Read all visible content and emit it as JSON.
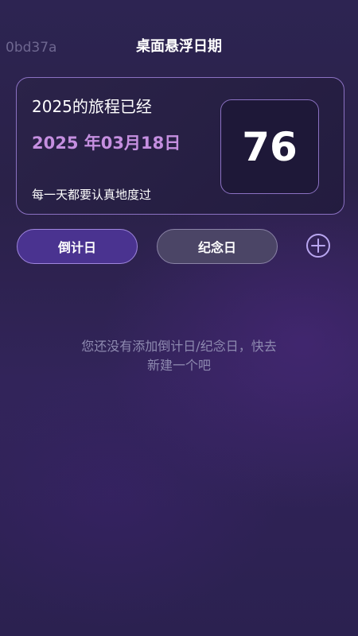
{
  "header": {
    "app_id": "0bd37a",
    "title": "桌面悬浮日期"
  },
  "card": {
    "heading": "2025的旅程已经",
    "date": "2025 年03月18日",
    "motto": "每一天都要认真地度过",
    "days_count": "76"
  },
  "tabs": [
    {
      "label": "倒计日",
      "selected": true
    },
    {
      "label": "纪念日",
      "selected": false
    }
  ],
  "add_button": {
    "icon": "plus-circle-icon"
  },
  "empty_state": {
    "line1": "您还没有添加倒计日/纪念日，快去",
    "line2": "新建一个吧"
  },
  "colors": {
    "accent": "#c58fe0",
    "selected_tab": "#4a3390",
    "unselected_tab": "#4b4566",
    "border": "#8b71c2"
  }
}
